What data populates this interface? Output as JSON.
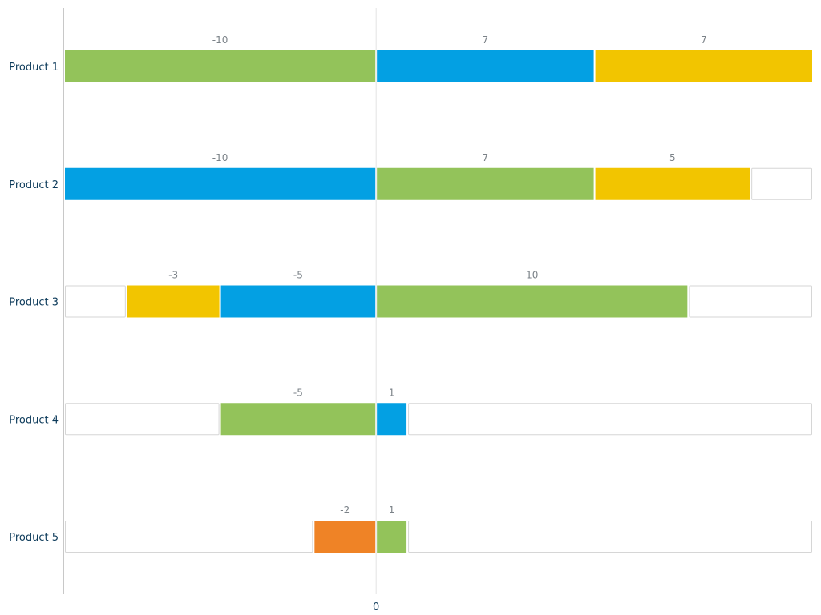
{
  "chart_data": {
    "type": "bar",
    "orientation": "horizontal",
    "stacked": true,
    "title": "",
    "xlabel": "",
    "ylabel": "",
    "xlim": [
      -10,
      14
    ],
    "x_ticks": [
      "0"
    ],
    "grid": false,
    "legend": "none",
    "categories": [
      "Product 1",
      "Product 2",
      "Product 3",
      "Product 4",
      "Product 5"
    ],
    "colors": {
      "green": "#93C35A",
      "blue": "#03A0E3",
      "yellow": "#F2C500",
      "orange": "#EF8326",
      "empty_fill": "#FFFFFF",
      "empty_stroke": "#D6D6D6"
    },
    "rows": [
      {
        "category": "Product 1",
        "negative": [
          {
            "value": -10,
            "color": "green"
          }
        ],
        "positive": [
          {
            "value": 7,
            "color": "blue"
          },
          {
            "value": 7,
            "color": "yellow"
          }
        ]
      },
      {
        "category": "Product 2",
        "negative": [
          {
            "value": -10,
            "color": "blue"
          }
        ],
        "positive": [
          {
            "value": 7,
            "color": "green"
          },
          {
            "value": 5,
            "color": "yellow"
          }
        ]
      },
      {
        "category": "Product 3",
        "negative": [
          {
            "value": -5,
            "color": "blue"
          },
          {
            "value": -3,
            "color": "yellow"
          }
        ],
        "positive": [
          {
            "value": 10,
            "color": "green"
          }
        ]
      },
      {
        "category": "Product 4",
        "negative": [
          {
            "value": -5,
            "color": "green"
          }
        ],
        "positive": [
          {
            "value": 1,
            "color": "blue"
          }
        ]
      },
      {
        "category": "Product 5",
        "negative": [
          {
            "value": -2,
            "color": "orange"
          }
        ],
        "positive": [
          {
            "value": 1,
            "color": "green"
          }
        ]
      }
    ]
  }
}
